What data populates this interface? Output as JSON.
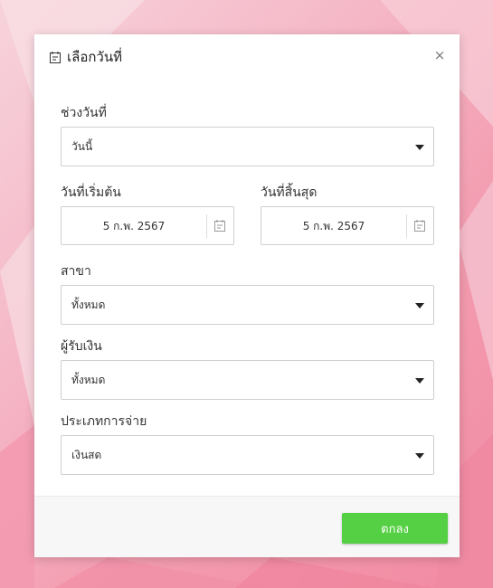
{
  "dialog": {
    "title": "เลือกวันที่",
    "close_label": "×"
  },
  "date_range": {
    "label": "ช่วงวันที่",
    "selected": "วันนี้"
  },
  "start_date": {
    "label": "วันที่เริ่มต้น",
    "value": "5 ก.พ. 2567"
  },
  "end_date": {
    "label": "วันที่สิ้นสุด",
    "value": "5 ก.พ. 2567"
  },
  "branch": {
    "label": "สาขา",
    "selected": "ทั้งหมด"
  },
  "payee": {
    "label": "ผู้รับเงิน",
    "selected": "ทั้งหมด"
  },
  "payment_type": {
    "label": "ประเภทการจ่าย",
    "selected": "เงินสด"
  },
  "footer": {
    "ok_label": "ตกลง"
  },
  "colors": {
    "ok_button": "#55cf43",
    "background": "#f5b7c6"
  }
}
